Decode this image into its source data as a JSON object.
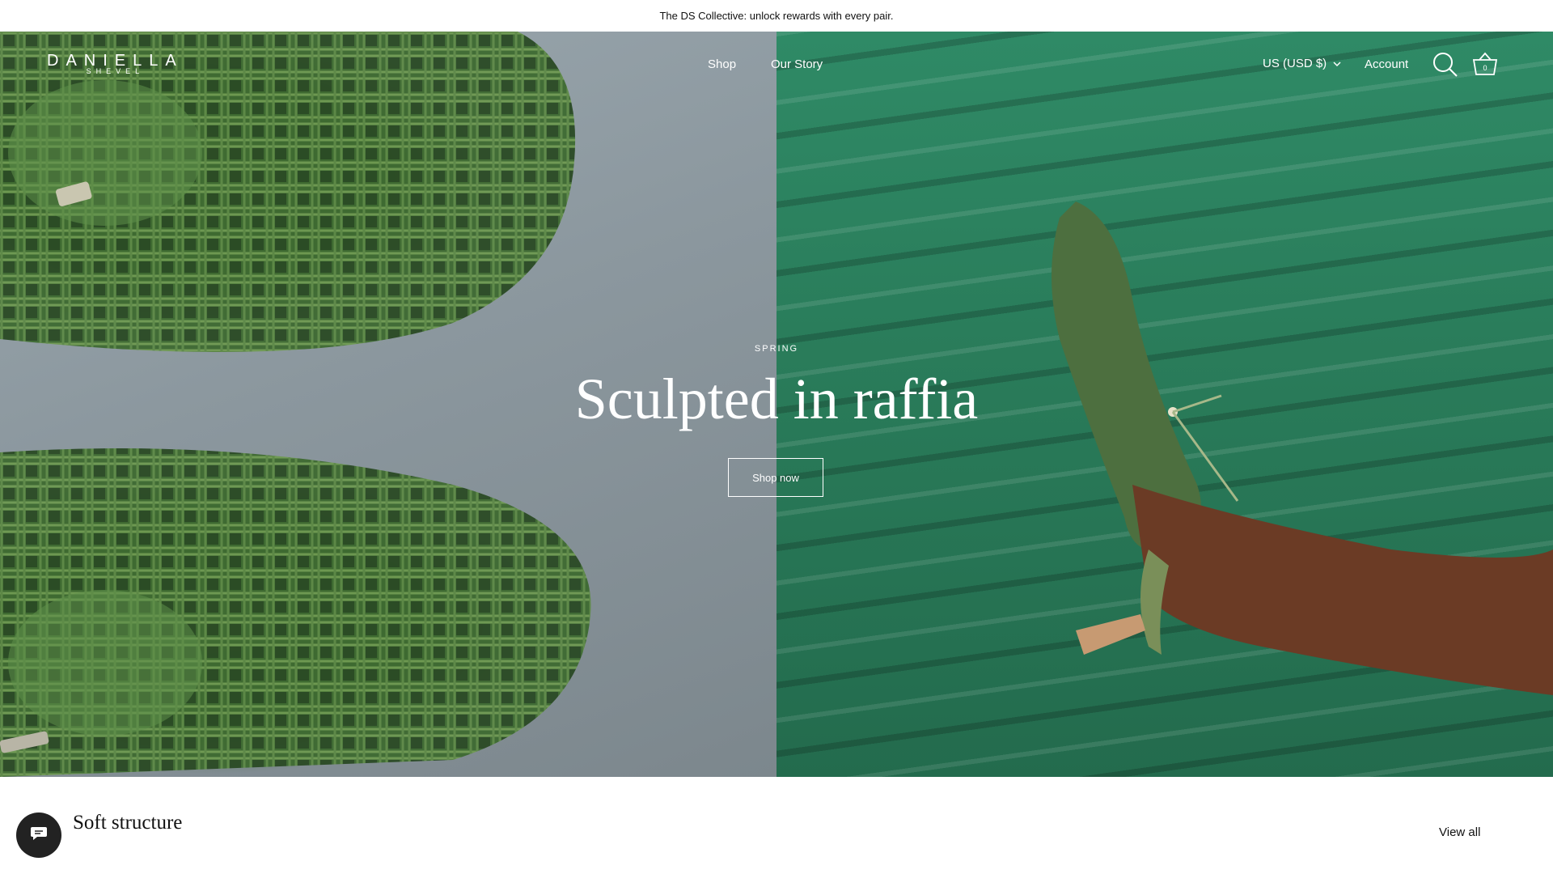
{
  "announcement": {
    "text": "The DS Collective: unlock rewards with every pair."
  },
  "header": {
    "logo_main": "DANIELLA",
    "logo_sub": "SHEVEL",
    "nav": [
      {
        "label": "Shop"
      },
      {
        "label": "Our Story"
      }
    ],
    "currency": "US (USD $)",
    "account": "Account",
    "cart_count": "0",
    "icons": [
      "search-icon",
      "basket-icon",
      "chevron-down-icon"
    ]
  },
  "hero": {
    "eyebrow": "SPRING",
    "headline": "Sculpted in raffia",
    "cta": "Shop now"
  },
  "collection": {
    "title": "Soft structure",
    "view_all": "View all"
  },
  "chat": {
    "icon": "chat-icon"
  },
  "colors": {
    "text_dark": "#111111",
    "hero_green": "#2a7d5b",
    "shoe_green": "#4f7a3e",
    "chat_bg": "#222222"
  }
}
